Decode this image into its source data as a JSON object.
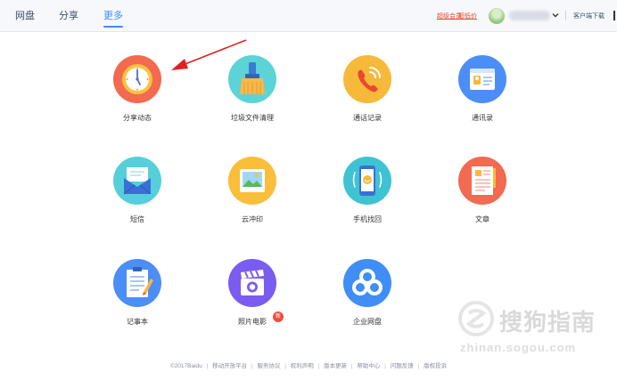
{
  "nav": {
    "tabs": [
      {
        "label": "网盘",
        "active": false
      },
      {
        "label": "分享",
        "active": false
      },
      {
        "label": "更多",
        "active": true
      }
    ]
  },
  "header": {
    "vip_links": [
      "超级会员",
      "超低价"
    ],
    "client_download": "客户端下载"
  },
  "apps": [
    {
      "label": "分享动态",
      "icon": "clock-icon",
      "color": "#f26a4f"
    },
    {
      "label": "垃圾文件清理",
      "icon": "broom-icon",
      "color": "#5cd3d6"
    },
    {
      "label": "通话记录",
      "icon": "phone-icon",
      "color": "#f7b93a"
    },
    {
      "label": "通讯录",
      "icon": "contacts-card-icon",
      "color": "#4c8ef7"
    },
    {
      "label": "短信",
      "icon": "envelope-icon",
      "color": "#55cfd9"
    },
    {
      "label": "云冲印",
      "icon": "photo-icon",
      "color": "#f9be3a"
    },
    {
      "label": "手机找回",
      "icon": "find-phone-icon",
      "color": "#3fc3d2"
    },
    {
      "label": "文章",
      "icon": "document-icon",
      "color": "#f26a4f"
    },
    {
      "label": "记事本",
      "icon": "notepad-icon",
      "color": "#4c8ef7"
    },
    {
      "label": "照片电影",
      "icon": "clapperboard-icon",
      "color": "#7a5cf0",
      "badge": "新"
    },
    {
      "label": "企业网盘",
      "icon": "cloud-icon",
      "color": "#3f8ef5"
    }
  ],
  "footer": {
    "copyright": "©2017Baidu",
    "links": [
      "移动开放平台",
      "服务协议",
      "权利声明",
      "版本更新",
      "帮助中心",
      "问题反馈",
      "版权投诉"
    ]
  },
  "watermark": {
    "text": "搜狗指南",
    "url": "zhinan.sogou.com"
  },
  "colors": {
    "accent": "#3b8cff",
    "vip": "#e8492f",
    "annotation_arrow": "#e02020"
  }
}
